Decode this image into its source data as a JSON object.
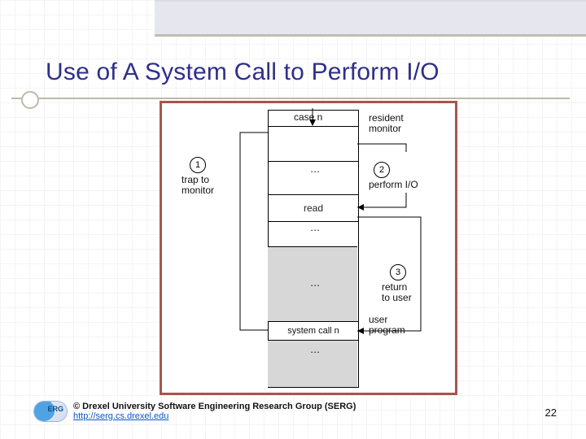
{
  "slide": {
    "title": "Use of A System Call to Perform I/O",
    "page_number": "22"
  },
  "diagram": {
    "case_label": "case n",
    "read_label": "read",
    "syscall_label": "system call n",
    "labels": {
      "resident_monitor": "resident\nmonitor",
      "user_program": "user\nprogram",
      "trap": "trap to\nmonitor",
      "perform": "perform I/O",
      "return": "return\nto user"
    },
    "circles": {
      "c1": "1",
      "c2": "2",
      "c3": "3"
    },
    "dots": "·\n·\n·"
  },
  "footer": {
    "copyright": "© Drexel University Software Engineering Research Group (SERG)",
    "url_text": "http://serg.cs.drexel.edu",
    "logo_text": "ERG"
  }
}
